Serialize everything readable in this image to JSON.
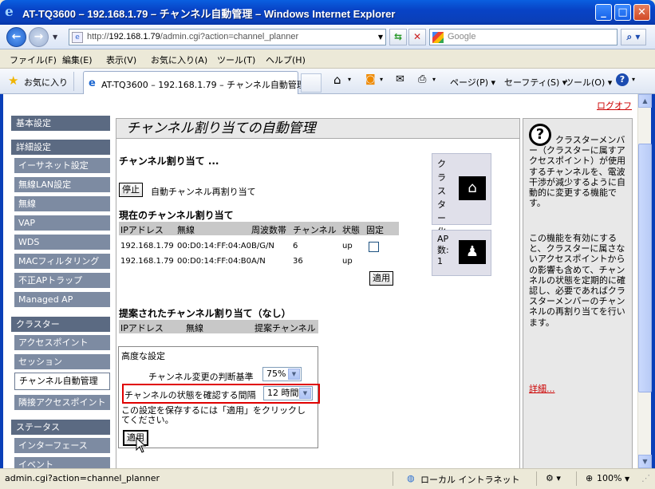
{
  "window": {
    "title": "AT-TQ3600 – 192.168.1.79 – チャンネル自動管理 – Windows Internet Explorer",
    "minimize": "_",
    "maximize": "□",
    "close": "✕"
  },
  "address": {
    "url_prefix": "http://",
    "url_host": "192.168.1.79",
    "url_path": "/admin.cgi?action=channel_planner",
    "search_placeholder": "Google"
  },
  "menu": [
    "ファイル(F)",
    "編集(E)",
    "表示(V)",
    "お気に入り(A)",
    "ツール(T)",
    "ヘルプ(H)"
  ],
  "favorites": {
    "label": "お気に入り",
    "tab_title": "AT-TQ3600 – 192.168.1.79 – チャンネル自動管理",
    "page_menu": "ページ(P)",
    "safety_menu": "セーフティ(S)",
    "tools_menu": "ツール(O)"
  },
  "page": {
    "logout": "ログオフ",
    "title": "チャンネル割り当ての自動管理",
    "sidebar": [
      {
        "label": "基本設定",
        "type": "header"
      },
      {
        "label": "詳細設定",
        "type": "header"
      },
      {
        "label": "イーサネット設定",
        "type": "sub"
      },
      {
        "label": "無線LAN設定",
        "type": "sub"
      },
      {
        "label": "無線",
        "type": "sub"
      },
      {
        "label": "VAP",
        "type": "sub"
      },
      {
        "label": "WDS",
        "type": "sub"
      },
      {
        "label": "MACフィルタリング",
        "type": "sub"
      },
      {
        "label": "不正APトラップ",
        "type": "sub"
      },
      {
        "label": "Managed AP",
        "type": "sub"
      },
      {
        "label": "クラスター",
        "type": "header"
      },
      {
        "label": "アクセスポイント",
        "type": "sub"
      },
      {
        "label": "セッション",
        "type": "sub"
      },
      {
        "label": "チャンネル自動管理",
        "type": "active"
      },
      {
        "label": "隣接アクセスポイント",
        "type": "sub"
      },
      {
        "label": "ステータス",
        "type": "header"
      },
      {
        "label": "インターフェース",
        "type": "sub"
      },
      {
        "label": "イベント",
        "type": "sub"
      }
    ],
    "assign": {
      "heading": "チャンネル割り当て ...",
      "stop_button": "停止",
      "stop_desc": "自動チャンネル再割り当て"
    },
    "current": {
      "heading": "現在のチャンネル割り当て",
      "columns": [
        "IPアドレス",
        "無線",
        "周波数帯",
        "チャンネル",
        "状態",
        "固定"
      ],
      "rows": [
        {
          "ip": "192.168.1.79",
          "radio": "00:D0:14:FF:04:A0",
          "band": "B/G/N",
          "channel": "6",
          "status": "up"
        },
        {
          "ip": "192.168.1.79",
          "radio": "00:D0:14:FF:04:B0",
          "band": "A/N",
          "channel": "36",
          "status": "up"
        }
      ],
      "apply_button": "適用"
    },
    "proposed": {
      "heading": "提案されたチャンネル割り当て（なし）",
      "columns": [
        "IPアドレス",
        "無線",
        "提案チャンネル"
      ]
    },
    "cluster_box": {
      "label": "クラスター化"
    },
    "ap_box": {
      "label": "AP数:",
      "count": "1"
    },
    "advanced": {
      "heading": "高度な設定",
      "threshold_label": "チャンネル変更の判断基準",
      "threshold_value": "75%",
      "interval_label": "チャンネルの状態を確認する間隔",
      "interval_value": "12 時間",
      "save_note": "この設定を保存するには「適用」をクリックしてください。",
      "apply_button": "適用"
    },
    "help": {
      "text1": "クラスターメンバー（クラスターに属すアクセスポイント）が使用するチャンネルを、電波干渉が減少するように自動的に変更する機能です。",
      "text2": "この機能を有効にすると、クラスターに属さないアクセスポイントからの影響も含めて、チャンネルの状態を定期的に確認し、必要であればクラスターメンバーのチャンネルの再割り当てを行います。",
      "more": "詳細..."
    }
  },
  "status": {
    "url": "admin.cgi?action=channel_planner",
    "zone": "ローカル イントラネット",
    "zoom": "100%"
  }
}
